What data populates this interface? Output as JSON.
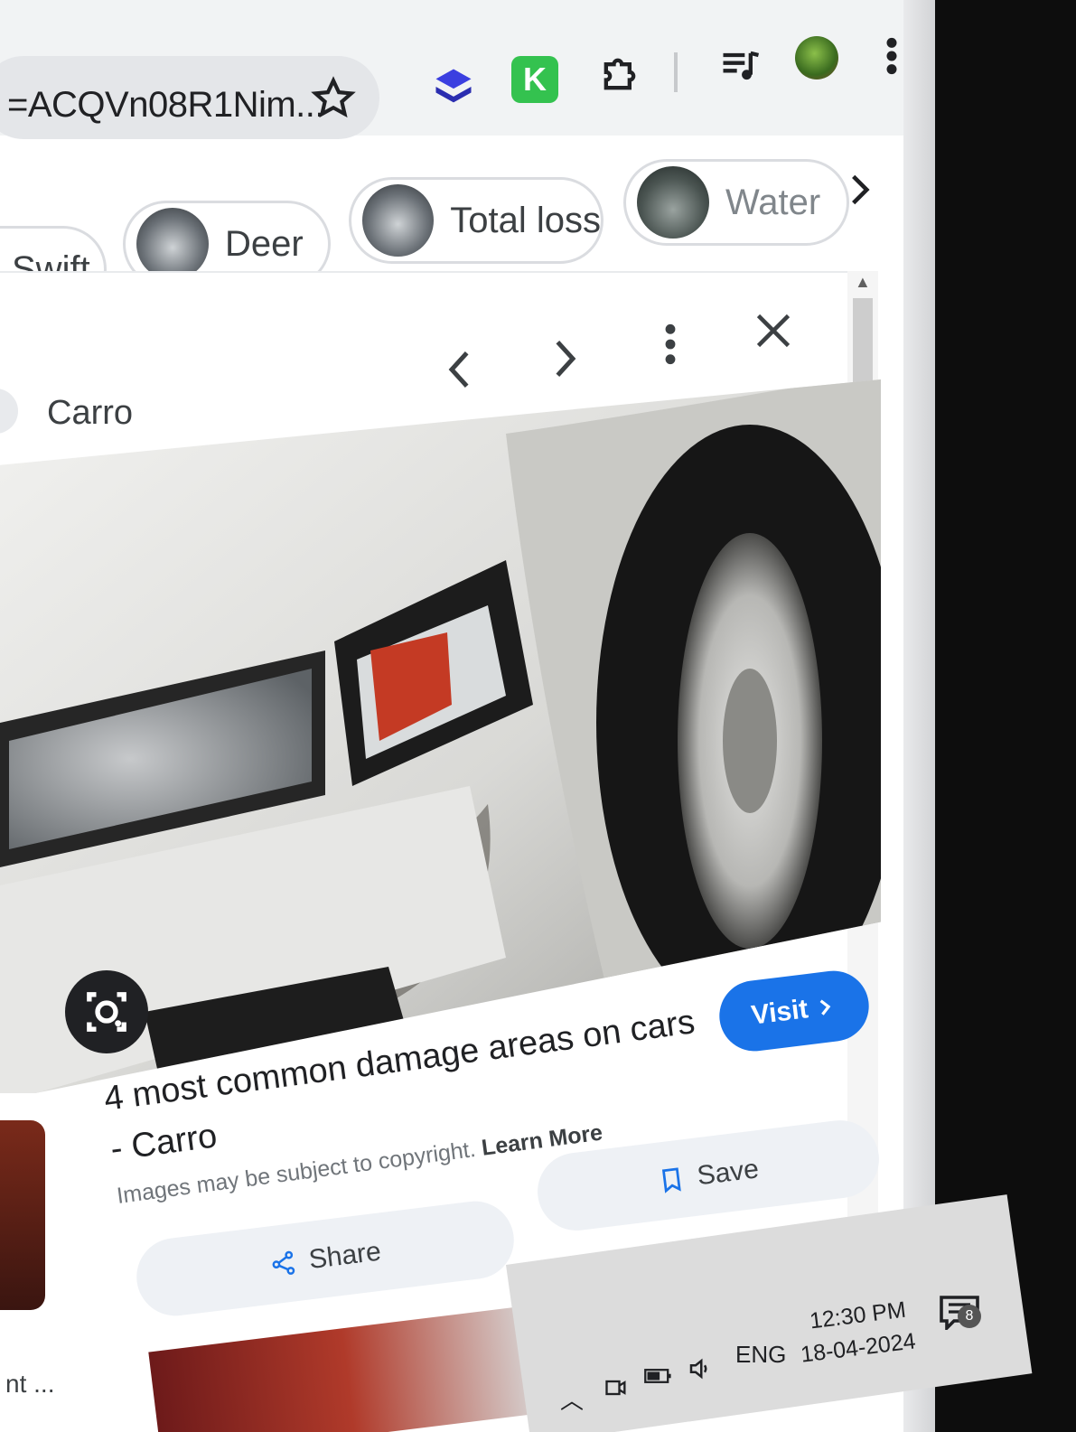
{
  "browser": {
    "url": "=ACQVn08R1Nim...",
    "icons": [
      "star-icon",
      "layers-extension-icon",
      "k-extension-icon",
      "puzzle-extension-icon",
      "media-control-icon",
      "profile-avatar",
      "more-vert-icon"
    ],
    "k_extension_label": "K"
  },
  "chips": [
    {
      "label": "Swift"
    },
    {
      "label": "Deer"
    },
    {
      "label": "Total loss"
    },
    {
      "label": "Water"
    }
  ],
  "panel": {
    "source": "Carro",
    "title": "4 most common damage areas on cars - Carro",
    "copyright_note": "Images may be subject to copyright.",
    "learn_more": "Learn More",
    "visit_label": "Visit",
    "save_label": "Save",
    "share_label": "Share",
    "lens_icon": "google-lens-icon"
  },
  "below": {
    "partial_text": "nt ..."
  },
  "taskbar": {
    "language": "ENG",
    "time": "12:30 PM",
    "date": "18-04-2024",
    "notifications": "8"
  },
  "colors": {
    "accent": "#1a73e8",
    "chip_border": "#dadce0",
    "pill_bg": "#eef1f5"
  }
}
